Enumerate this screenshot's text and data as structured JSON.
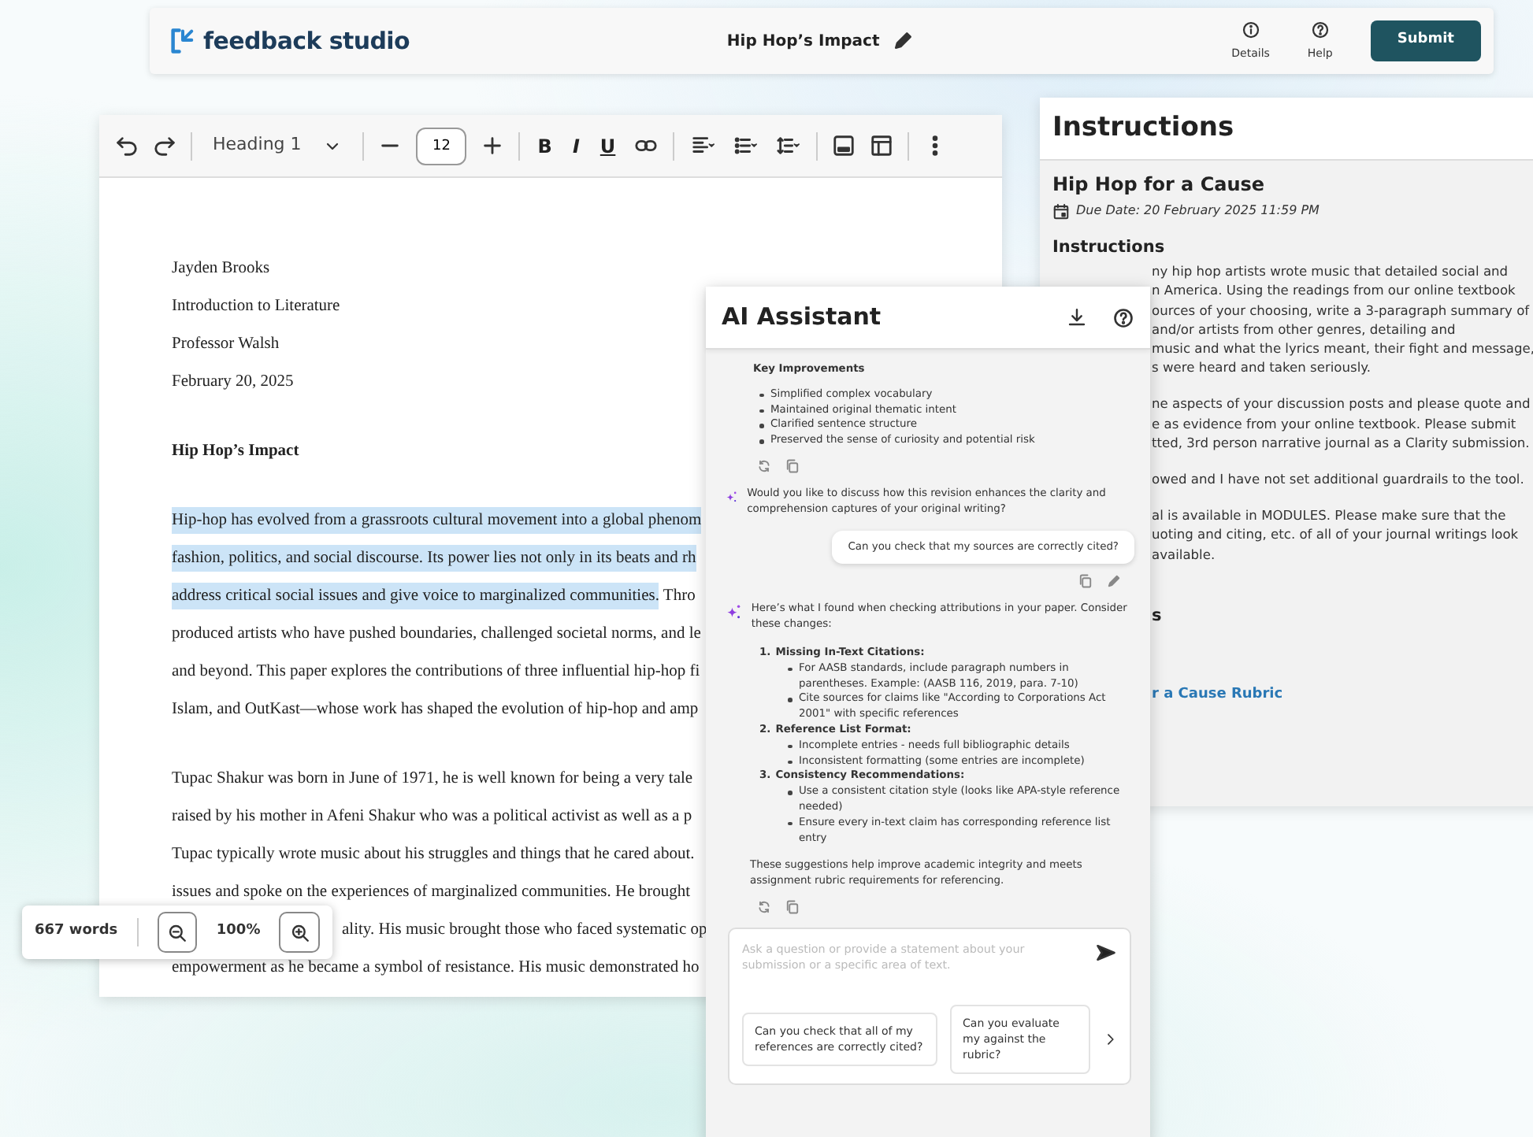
{
  "top_bar": {
    "logo_text": "feedback studio",
    "document_title": "Hip Hop’s Impact",
    "actions": [
      {
        "kind": "details",
        "label": "Details"
      },
      {
        "kind": "help",
        "label": "Help"
      }
    ],
    "submit": "Submit"
  },
  "toolbar": {
    "style": "Heading 1",
    "font_size": "12",
    "format": [
      "B",
      "I",
      "U"
    ]
  },
  "document": {
    "header_lines": [
      "Jayden Brooks",
      "Introduction to Literature",
      "Professor Walsh",
      "February 20, 2025"
    ],
    "title": "Hip Hop’s Impact",
    "paragraphs": [
      [
        [
          {
            "text": "Hip-hop has evolved from a grassroots cultural movement into a global phenom",
            "highlighted": true
          }
        ],
        [
          {
            "text": "fashion, politics, and social discourse. Its power lies not only in its beats and rh",
            "highlighted": true
          }
        ],
        [
          {
            "text": "address critical social issues and give voice to marginalized communities.",
            "highlighted": true
          },
          {
            "text": " Thro",
            "highlighted": false
          }
        ],
        [
          {
            "text": "produced artists who have pushed boundaries, challenged societal norms, and le",
            "highlighted": false
          }
        ],
        [
          {
            "text": "and beyond. This paper explores the contributions of three influential hip-hop fi",
            "highlighted": false
          }
        ],
        [
          {
            "text": "Islam, and OutKast—whose work has shaped the evolution of hip-hop and amp",
            "highlighted": false
          }
        ]
      ],
      [
        [
          {
            "text": "Tupac Shakur was born in June of 1971, he is well known for being a very tale",
            "highlighted": false
          }
        ],
        [
          {
            "text": "raised by his mother in Afeni Shakur who was a political activist as well as a p",
            "highlighted": false
          }
        ],
        [
          {
            "text": "Tupac typically wrote music about his struggles and things that he cared about.",
            "highlighted": false
          }
        ],
        [
          {
            "text": "issues and spoke on the experiences of marginalized communities. He brought",
            "highlighted": false
          }
        ],
        [
          {
            "text": "ality. His music brought those who faced systematic op",
            "highlighted": false
          }
        ],
        [
          {
            "text": "empowerment as he became a symbol of resistance. His music demonstrated ho",
            "highlighted": false
          }
        ]
      ]
    ]
  },
  "word_count": {
    "count": "667 words",
    "zoom": "100%"
  },
  "instructions_panel": {
    "title": "Instructions",
    "assignment": "Hip Hop for a Cause",
    "due_date": "Due Date: 20 February 2025 11:59 PM",
    "subheading": "Instructions",
    "paragraphs": [
      [
        "ny hip hop artists wrote music that detailed social and",
        "n America. Using the readings from our online textbook",
        "ources of your choosing, write a 3-paragraph summary of",
        "and/or artists from other genres, detailing and",
        "music and what the lyrics meant, their fight and message,",
        "s were heard and taken seriously."
      ],
      [
        "ne aspects of your discussion posts and please quote and",
        "e as evidence from your online textbook. Please submit",
        "tted, 3rd person narrative journal as a Clarity submission."
      ],
      [
        "owed and I have not set additional guardrails to the tool."
      ],
      [
        "al is available in MODULES. Please make sure that the",
        "uoting and citing, etc. of all of your journal writings look",
        "available."
      ]
    ],
    "section_fragment": "s",
    "rubric_link": "r a Cause Rubric"
  },
  "ai_assistant": {
    "title": "AI Assistant",
    "messages": [
      {
        "kind": "summary",
        "heading": "Key Improvements",
        "bullets": [
          "Simplified complex vocabulary",
          "Maintained original thematic intent",
          "Clarified sentence structure",
          "Preserved the sense of curiosity and potential risk"
        ]
      },
      {
        "kind": "assistant",
        "text": "Would you like to discuss how this revision enhances the clarity and comprehension captures of your original writing?"
      },
      {
        "kind": "user",
        "text": "Can you check that my sources are correctly cited?"
      },
      {
        "kind": "findings",
        "intro": "Here’s what I found when checking attributions in your paper. Consider these changes:",
        "sections": [
          {
            "number": "1.",
            "title": "Missing In-Text Citations:",
            "bullets": [
              "For AASB standards, include paragraph numbers in parentheses. Example: (AASB 116, 2019, para. 7-10)",
              "Cite sources for claims like \"According to Corporations Act 2001\" with specific references"
            ]
          },
          {
            "number": "2.",
            "title": "Reference List Format:",
            "bullets": [
              "Incomplete entries - needs full bibliographic details",
              "Inconsistent formatting (some entries are incomplete)"
            ]
          },
          {
            "number": "3.",
            "title": "Consistency Recommendations:",
            "bullets": [
              "Use a consistent citation style (looks like APA-style reference needed)",
              "Ensure every in-text claim has corresponding reference list entry"
            ]
          }
        ],
        "closing": "These suggestions help improve academic integrity and meets assignment rubric requirements for referencing."
      }
    ],
    "input_placeholder": "Ask a question or provide a statement about your submission or a specific area of text.",
    "suggestions": [
      "Can you check that all of my references are correctly cited?",
      "Can you evaluate my against the rubric?"
    ]
  }
}
